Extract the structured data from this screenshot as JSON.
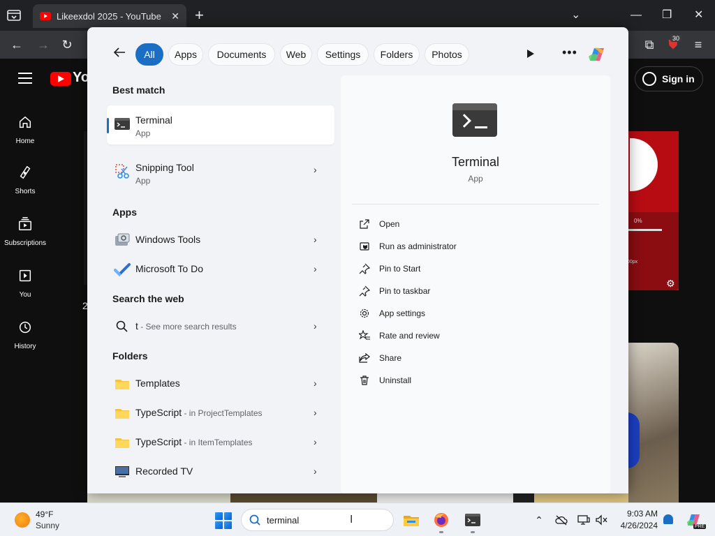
{
  "browser": {
    "tab_title": "Likeexdol 2025 - YouTube",
    "tab_close": "✕",
    "new_tab": "+",
    "extensions_badge": "30"
  },
  "youtube": {
    "logo_text": "You",
    "sign_in": "Sign in",
    "nav": [
      {
        "label": "Home"
      },
      {
        "label": "Shorts"
      },
      {
        "label": "Subscriptions"
      },
      {
        "label": "You"
      },
      {
        "label": "History"
      }
    ],
    "fragment_text": "2",
    "video_overlay": {
      "percent": "0%",
      "size": "00px"
    }
  },
  "search": {
    "filters": [
      "All",
      "Apps",
      "Documents",
      "Web",
      "Settings",
      "Folders",
      "Photos"
    ],
    "active_filter": "All",
    "best_match_title": "Best match",
    "best_match": {
      "name": "Terminal",
      "type": "App"
    },
    "second_match": {
      "name": "Snipping Tool",
      "type": "App"
    },
    "apps_title": "Apps",
    "apps": [
      {
        "name": "Windows Tools"
      },
      {
        "name": "Microsoft To Do"
      }
    ],
    "web_title": "Search the web",
    "web_result": {
      "query": "t",
      "hint": " - See more search results"
    },
    "folders_title": "Folders",
    "folders": [
      {
        "name": "Templates",
        "hint": ""
      },
      {
        "name": "TypeScript",
        "hint": " - in ProjectTemplates"
      },
      {
        "name": "TypeScript",
        "hint": " - in ItemTemplates"
      },
      {
        "name": "Recorded TV",
        "hint": ""
      }
    ],
    "detail": {
      "name": "Terminal",
      "type": "App",
      "actions": [
        {
          "label": "Open",
          "icon": "open-external-icon"
        },
        {
          "label": "Run as administrator",
          "icon": "shield-icon"
        },
        {
          "label": "Pin to Start",
          "icon": "pin-icon"
        },
        {
          "label": "Pin to taskbar",
          "icon": "pin-icon"
        },
        {
          "label": "App settings",
          "icon": "gear-icon"
        },
        {
          "label": "Rate and review",
          "icon": "star-icon"
        },
        {
          "label": "Share",
          "icon": "share-icon"
        },
        {
          "label": "Uninstall",
          "icon": "trash-icon"
        }
      ]
    },
    "more_label": "•••"
  },
  "taskbar": {
    "weather_temp": "49°F",
    "weather_condition": "Sunny",
    "search_text": "terminal",
    "time": "9:03 AM",
    "date": "4/26/2024",
    "copilot_badge": "PRE"
  },
  "colors": {
    "accent": "#1a6fc4",
    "youtube_red": "#ff0000",
    "panel_bg": "#f1f3f6"
  }
}
